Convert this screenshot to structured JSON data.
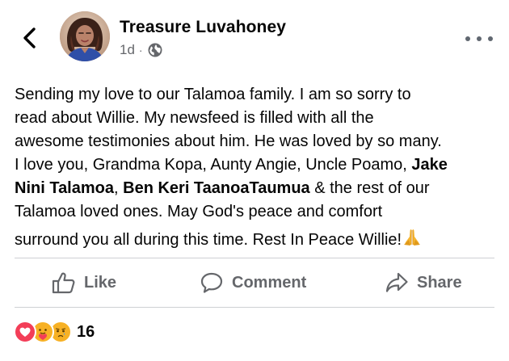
{
  "header": {
    "author_name": "Treasure Luvahoney",
    "timestamp": "1d",
    "separator": "·",
    "audience_icon": "globe-icon",
    "back_icon": "chevron-left-icon",
    "more_icon": "more-horizontal-icon"
  },
  "post": {
    "lines": [
      "Sending my love to our Talamoa family.  I am so sorry to",
      "read about Willie.  My newsfeed is filled with all the",
      "awesome testimonies about him.  He was loved by so many.",
      "I love you, Grandma Kopa, Aunty Angie, Uncle Poamo, "
    ],
    "mention_1_part_a": "Jake",
    "mention_1_part_b": "Nini Talamoa",
    "mention_2": "Ben Keri TaanoaTaumua",
    "comma": ", ",
    "after_mentions": " & the rest of our",
    "line_7": "Talamoa loved ones.  May God's peace and comfort",
    "line_8": "surround you all during this time.  Rest In Peace Willie!",
    "emoji": "praying-hands-emoji"
  },
  "actions": {
    "like_label": "Like",
    "comment_label": "Comment",
    "share_label": "Share"
  },
  "reactions": {
    "types": [
      "love",
      "care",
      "sad"
    ],
    "count": "16"
  },
  "colors": {
    "text": "#050505",
    "secondary_text": "#65676b",
    "divider": "#ced0d4",
    "love": "#f33e58",
    "care_sad": "#f7b125"
  }
}
